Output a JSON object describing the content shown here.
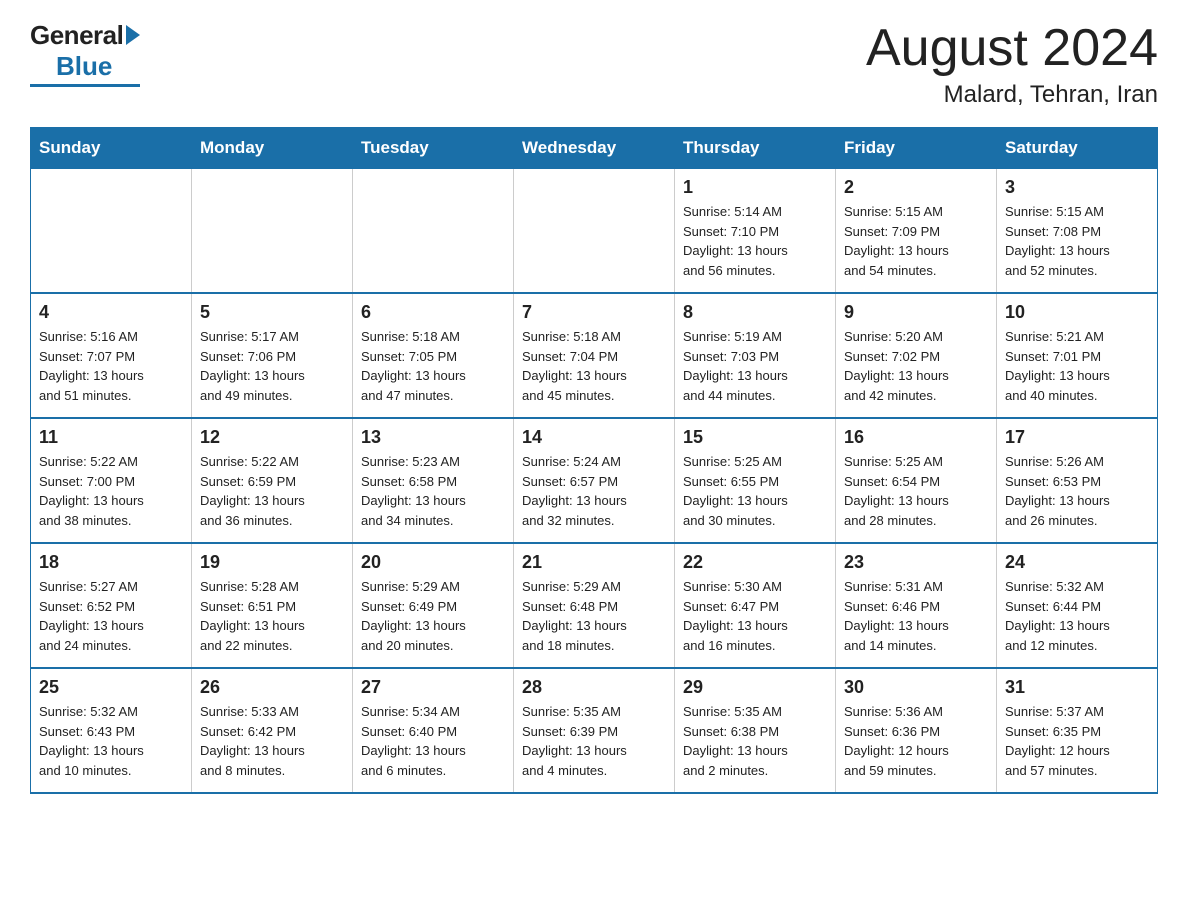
{
  "header": {
    "logo_general": "General",
    "logo_blue": "Blue",
    "month_title": "August 2024",
    "location": "Malard, Tehran, Iran"
  },
  "calendar": {
    "days_of_week": [
      "Sunday",
      "Monday",
      "Tuesday",
      "Wednesday",
      "Thursday",
      "Friday",
      "Saturday"
    ],
    "weeks": [
      [
        {
          "day": "",
          "info": ""
        },
        {
          "day": "",
          "info": ""
        },
        {
          "day": "",
          "info": ""
        },
        {
          "day": "",
          "info": ""
        },
        {
          "day": "1",
          "info": "Sunrise: 5:14 AM\nSunset: 7:10 PM\nDaylight: 13 hours\nand 56 minutes."
        },
        {
          "day": "2",
          "info": "Sunrise: 5:15 AM\nSunset: 7:09 PM\nDaylight: 13 hours\nand 54 minutes."
        },
        {
          "day": "3",
          "info": "Sunrise: 5:15 AM\nSunset: 7:08 PM\nDaylight: 13 hours\nand 52 minutes."
        }
      ],
      [
        {
          "day": "4",
          "info": "Sunrise: 5:16 AM\nSunset: 7:07 PM\nDaylight: 13 hours\nand 51 minutes."
        },
        {
          "day": "5",
          "info": "Sunrise: 5:17 AM\nSunset: 7:06 PM\nDaylight: 13 hours\nand 49 minutes."
        },
        {
          "day": "6",
          "info": "Sunrise: 5:18 AM\nSunset: 7:05 PM\nDaylight: 13 hours\nand 47 minutes."
        },
        {
          "day": "7",
          "info": "Sunrise: 5:18 AM\nSunset: 7:04 PM\nDaylight: 13 hours\nand 45 minutes."
        },
        {
          "day": "8",
          "info": "Sunrise: 5:19 AM\nSunset: 7:03 PM\nDaylight: 13 hours\nand 44 minutes."
        },
        {
          "day": "9",
          "info": "Sunrise: 5:20 AM\nSunset: 7:02 PM\nDaylight: 13 hours\nand 42 minutes."
        },
        {
          "day": "10",
          "info": "Sunrise: 5:21 AM\nSunset: 7:01 PM\nDaylight: 13 hours\nand 40 minutes."
        }
      ],
      [
        {
          "day": "11",
          "info": "Sunrise: 5:22 AM\nSunset: 7:00 PM\nDaylight: 13 hours\nand 38 minutes."
        },
        {
          "day": "12",
          "info": "Sunrise: 5:22 AM\nSunset: 6:59 PM\nDaylight: 13 hours\nand 36 minutes."
        },
        {
          "day": "13",
          "info": "Sunrise: 5:23 AM\nSunset: 6:58 PM\nDaylight: 13 hours\nand 34 minutes."
        },
        {
          "day": "14",
          "info": "Sunrise: 5:24 AM\nSunset: 6:57 PM\nDaylight: 13 hours\nand 32 minutes."
        },
        {
          "day": "15",
          "info": "Sunrise: 5:25 AM\nSunset: 6:55 PM\nDaylight: 13 hours\nand 30 minutes."
        },
        {
          "day": "16",
          "info": "Sunrise: 5:25 AM\nSunset: 6:54 PM\nDaylight: 13 hours\nand 28 minutes."
        },
        {
          "day": "17",
          "info": "Sunrise: 5:26 AM\nSunset: 6:53 PM\nDaylight: 13 hours\nand 26 minutes."
        }
      ],
      [
        {
          "day": "18",
          "info": "Sunrise: 5:27 AM\nSunset: 6:52 PM\nDaylight: 13 hours\nand 24 minutes."
        },
        {
          "day": "19",
          "info": "Sunrise: 5:28 AM\nSunset: 6:51 PM\nDaylight: 13 hours\nand 22 minutes."
        },
        {
          "day": "20",
          "info": "Sunrise: 5:29 AM\nSunset: 6:49 PM\nDaylight: 13 hours\nand 20 minutes."
        },
        {
          "day": "21",
          "info": "Sunrise: 5:29 AM\nSunset: 6:48 PM\nDaylight: 13 hours\nand 18 minutes."
        },
        {
          "day": "22",
          "info": "Sunrise: 5:30 AM\nSunset: 6:47 PM\nDaylight: 13 hours\nand 16 minutes."
        },
        {
          "day": "23",
          "info": "Sunrise: 5:31 AM\nSunset: 6:46 PM\nDaylight: 13 hours\nand 14 minutes."
        },
        {
          "day": "24",
          "info": "Sunrise: 5:32 AM\nSunset: 6:44 PM\nDaylight: 13 hours\nand 12 minutes."
        }
      ],
      [
        {
          "day": "25",
          "info": "Sunrise: 5:32 AM\nSunset: 6:43 PM\nDaylight: 13 hours\nand 10 minutes."
        },
        {
          "day": "26",
          "info": "Sunrise: 5:33 AM\nSunset: 6:42 PM\nDaylight: 13 hours\nand 8 minutes."
        },
        {
          "day": "27",
          "info": "Sunrise: 5:34 AM\nSunset: 6:40 PM\nDaylight: 13 hours\nand 6 minutes."
        },
        {
          "day": "28",
          "info": "Sunrise: 5:35 AM\nSunset: 6:39 PM\nDaylight: 13 hours\nand 4 minutes."
        },
        {
          "day": "29",
          "info": "Sunrise: 5:35 AM\nSunset: 6:38 PM\nDaylight: 13 hours\nand 2 minutes."
        },
        {
          "day": "30",
          "info": "Sunrise: 5:36 AM\nSunset: 6:36 PM\nDaylight: 12 hours\nand 59 minutes."
        },
        {
          "day": "31",
          "info": "Sunrise: 5:37 AM\nSunset: 6:35 PM\nDaylight: 12 hours\nand 57 minutes."
        }
      ]
    ]
  }
}
